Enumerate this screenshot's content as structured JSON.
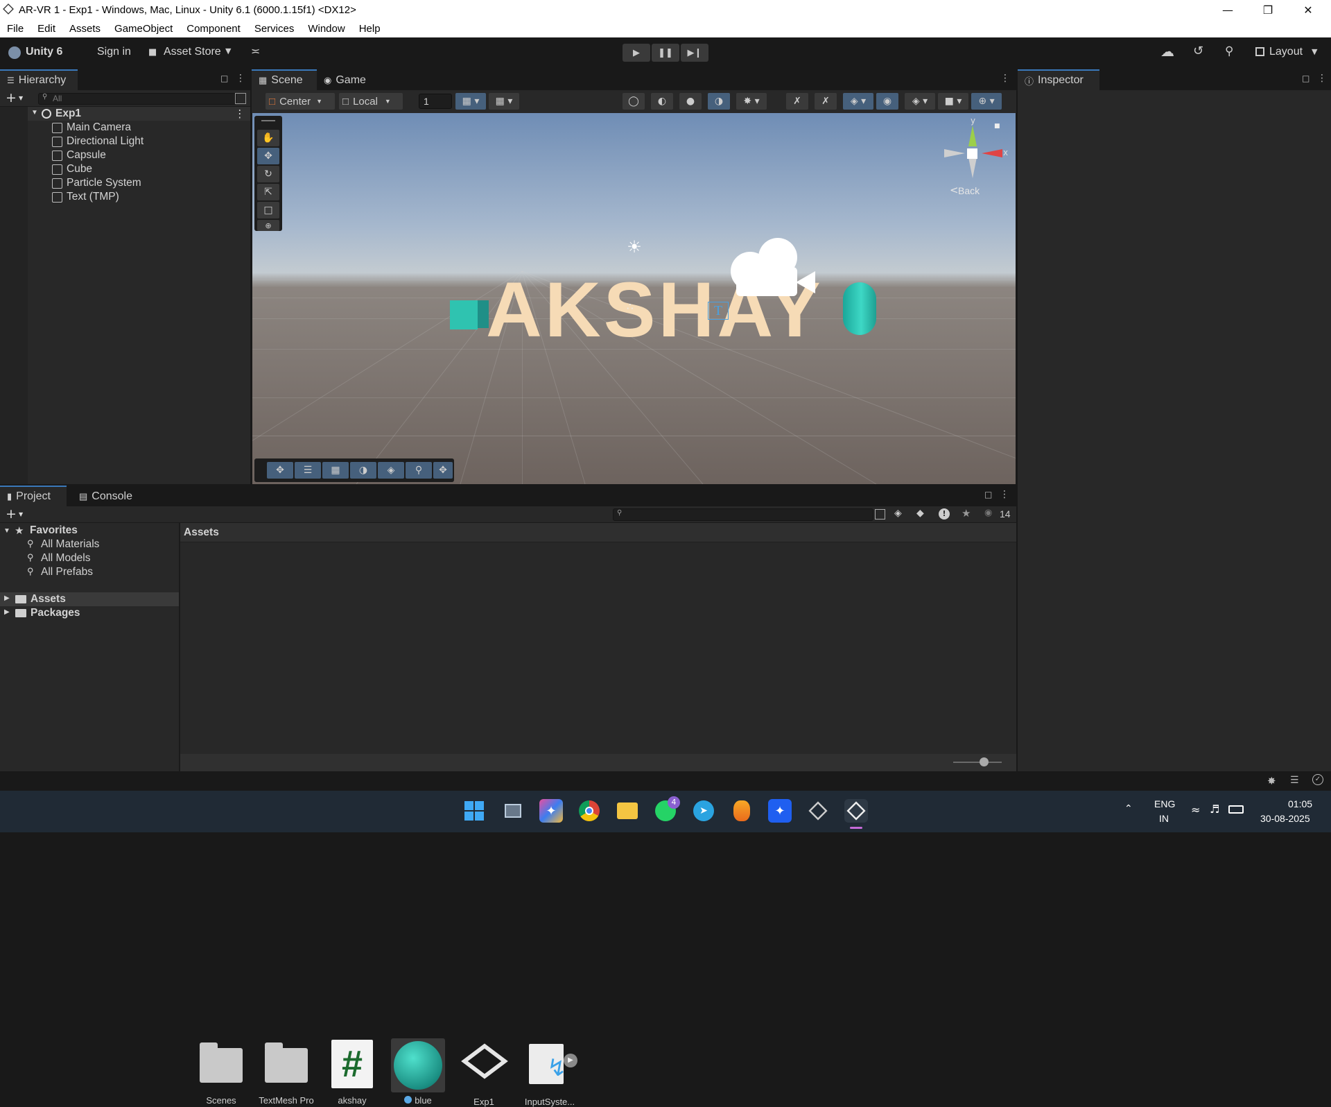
{
  "window": {
    "title": "AR-VR 1 - Exp1 - Windows, Mac, Linux - Unity 6.1 (6000.1.15f1) <DX12>",
    "minimize_icon": "minimize-icon",
    "maximize_icon": "restore-icon",
    "close_icon": "close-icon"
  },
  "menu": [
    "File",
    "Edit",
    "Assets",
    "GameObject",
    "Component",
    "Services",
    "Window",
    "Help"
  ],
  "toolbar": {
    "unity_label": "Unity 6",
    "signin_label": "Sign in",
    "asset_store_label": "Asset Store",
    "layout_label": "Layout"
  },
  "hierarchy": {
    "tab_label": "Hierarchy",
    "search_placeholder": "All",
    "scene_name": "Exp1",
    "items": [
      "Main Camera",
      "Directional Light",
      "Capsule",
      "Cube",
      "Particle System",
      "Text (TMP)"
    ]
  },
  "scene": {
    "tabs": [
      "Scene",
      "Game"
    ],
    "pivot_label": "Center",
    "space_label": "Local",
    "grid_value": "1",
    "gizmo_back_label": "Back",
    "gizmo_y": "y",
    "gizmo_x": "x",
    "text_object": "AKSHAY",
    "text_color": "#f5d9b3",
    "cube_color": "#2fc3b0",
    "capsule_color": "#29c4b0"
  },
  "inspector": {
    "tab_label": "Inspector"
  },
  "project": {
    "tabs": [
      "Project",
      "Console"
    ],
    "hidden_count": "14",
    "favorites_label": "Favorites",
    "favorites": [
      "All Materials",
      "All Models",
      "All Prefabs"
    ],
    "roots": [
      "Assets",
      "Packages"
    ],
    "breadcrumb": "Assets",
    "assets": [
      {
        "name": "Scenes",
        "icon": "folder-icon"
      },
      {
        "name": "TextMesh Pro",
        "icon": "folder-icon"
      },
      {
        "name": "akshay",
        "icon": "script-icon"
      },
      {
        "name": "blue",
        "icon": "material-icon"
      },
      {
        "name": "Exp1",
        "icon": "unity-scene-icon"
      },
      {
        "name": "InputSyste...",
        "icon": "input-actions-icon"
      }
    ],
    "script_glyph": "#"
  },
  "taskbar": {
    "lang_top": "ENG",
    "lang_bottom": "IN",
    "time": "01:05",
    "date": "30-08-2025",
    "whatsapp_badge": "4"
  }
}
